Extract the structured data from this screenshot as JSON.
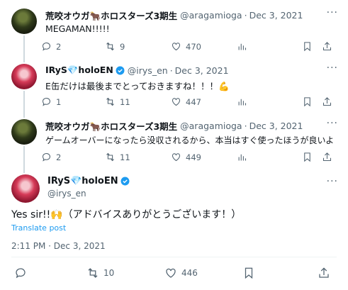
{
  "tweets": [
    {
      "name": "荒咬オウガ🐂ホロスターズ3期生",
      "handle": "@aragamioga",
      "date": "Dec 3, 2021",
      "text": "MEGAMAN!!!!!",
      "replies": "2",
      "retweets": "9",
      "likes": "470"
    },
    {
      "name": "IRyS💎holoEN",
      "handle": "@irys_en",
      "date": "Dec 3, 2021",
      "text": "E缶だけは最後までとっておきますね！！！💪",
      "replies": "1",
      "retweets": "11",
      "likes": "447"
    },
    {
      "name": "荒咬オウガ🐂ホロスターズ3期生",
      "handle": "@aragamioga",
      "date": "Dec 3, 2021",
      "text": "ゲームオーバーになったら没収されるから、本当はすぐ使ったほうが良いよ",
      "replies": "2",
      "retweets": "11",
      "likes": "449"
    }
  ],
  "focus": {
    "name": "IRyS💎holoEN",
    "handle": "@irys_en",
    "text": "Yes sir!!🙌（アドバイスありがとうございます！）",
    "translate": "Translate post",
    "timestamp": "2:11 PM · Dec 3, 2021",
    "retweets": "10",
    "likes": "446"
  },
  "ui": {
    "more": "···",
    "separator": "·"
  },
  "colors": {
    "verified": "#1d9bf0",
    "link": "#1d9bf0",
    "muted": "#536471"
  }
}
